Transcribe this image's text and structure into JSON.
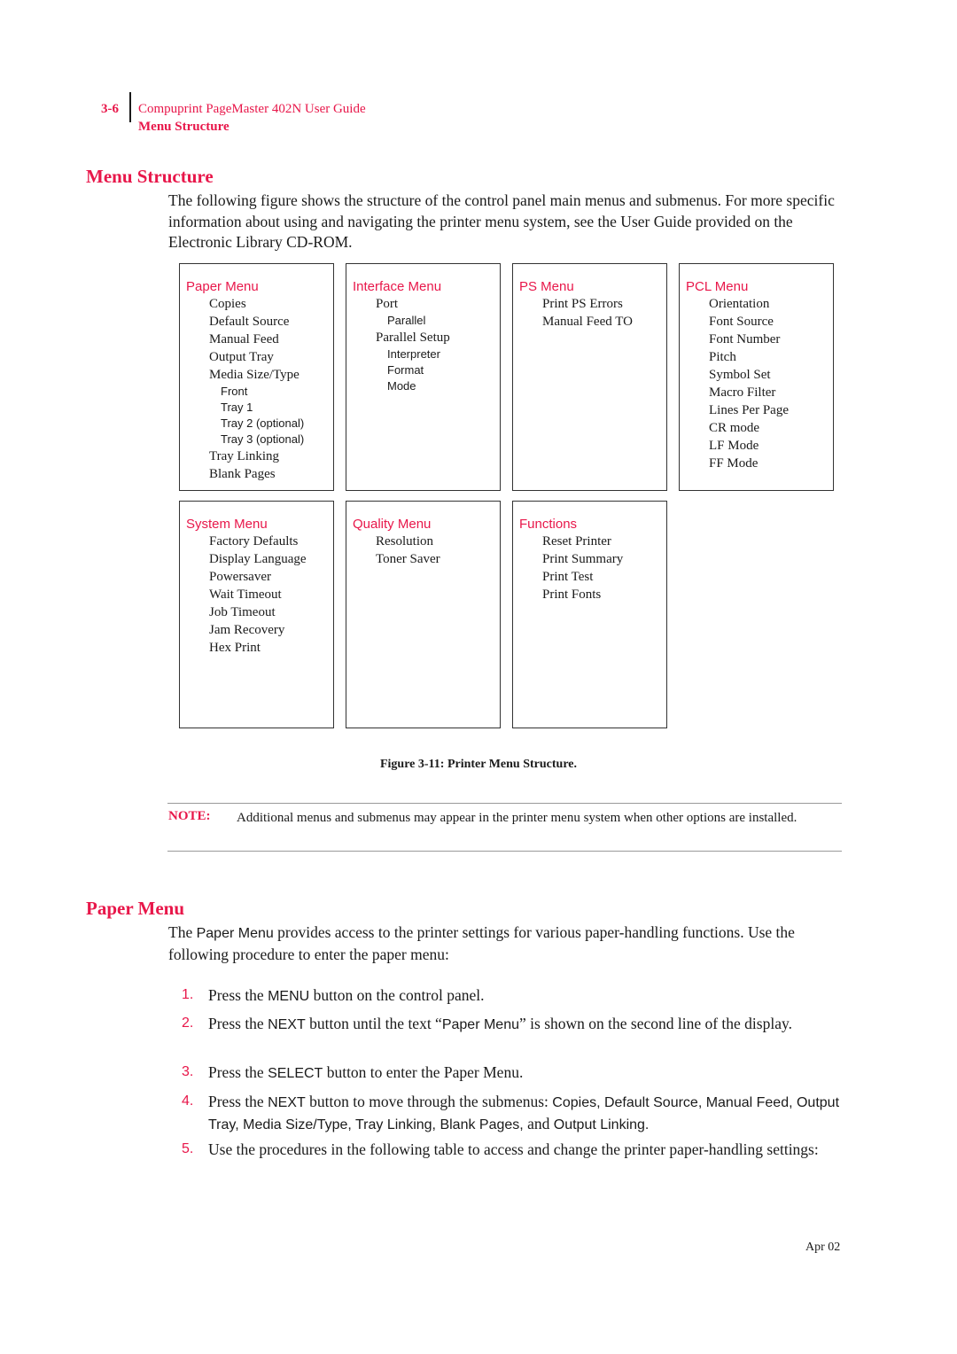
{
  "header": {
    "page_number": "3-6",
    "book_title": "Compuprint PageMaster 402N User Guide",
    "section": "Menu Structure"
  },
  "menu_structure": {
    "heading": "Menu Structure",
    "intro": "The following figure shows the structure of the control panel main menus and submenus. For more specific information about using and navigating the printer menu system, see the User Guide provided on the Electronic Library CD-ROM."
  },
  "figure": {
    "menus": [
      {
        "title": "Paper Menu",
        "items": [
          {
            "label": "Copies",
            "level": 1
          },
          {
            "label": "Default Source",
            "level": 1
          },
          {
            "label": "Manual Feed",
            "level": 1
          },
          {
            "label": "Output Tray",
            "level": 1
          },
          {
            "label": "Media Size/Type",
            "level": 1
          },
          {
            "label": "Front",
            "level": 2
          },
          {
            "label": "Tray 1",
            "level": 2
          },
          {
            "label": "Tray 2 (optional)",
            "level": 2
          },
          {
            "label": "Tray 3 (optional)",
            "level": 2
          },
          {
            "label": "Tray Linking",
            "level": 1
          },
          {
            "label": "Blank Pages",
            "level": 1
          }
        ]
      },
      {
        "title": "Interface Menu",
        "items": [
          {
            "label": "Port",
            "level": 1
          },
          {
            "label": "Parallel",
            "level": 2
          },
          {
            "label": "Parallel Setup",
            "level": 1
          },
          {
            "label": "Interpreter",
            "level": 2
          },
          {
            "label": "Format",
            "level": 2
          },
          {
            "label": "Mode",
            "level": 2
          }
        ]
      },
      {
        "title": "PS Menu",
        "items": [
          {
            "label": "Print PS Errors",
            "level": 1
          },
          {
            "label": "Manual Feed TO",
            "level": 1
          }
        ]
      },
      {
        "title": "PCL Menu",
        "items": [
          {
            "label": "Orientation",
            "level": 1
          },
          {
            "label": "Font Source",
            "level": 1
          },
          {
            "label": "Font Number",
            "level": 1
          },
          {
            "label": "Pitch",
            "level": 1
          },
          {
            "label": "Symbol Set",
            "level": 1
          },
          {
            "label": "Macro Filter",
            "level": 1
          },
          {
            "label": "Lines Per Page",
            "level": 1
          },
          {
            "label": "CR mode",
            "level": 1
          },
          {
            "label": "LF Mode",
            "level": 1
          },
          {
            "label": "FF Mode",
            "level": 1
          }
        ]
      },
      {
        "title": "System Menu",
        "items": [
          {
            "label": "Factory Defaults",
            "level": 1
          },
          {
            "label": "Display Language",
            "level": 1
          },
          {
            "label": "Powersaver",
            "level": 1
          },
          {
            "label": "Wait Timeout",
            "level": 1
          },
          {
            "label": "Job Timeout",
            "level": 1
          },
          {
            "label": "Jam Recovery",
            "level": 1
          },
          {
            "label": "Hex Print",
            "level": 1
          }
        ]
      },
      {
        "title": "Quality Menu",
        "items": [
          {
            "label": "Resolution",
            "level": 1
          },
          {
            "label": "Toner Saver",
            "level": 1
          }
        ]
      },
      {
        "title": "Functions",
        "items": [
          {
            "label": "Reset Printer",
            "level": 1
          },
          {
            "label": "Print Summary",
            "level": 1
          },
          {
            "label": "Print Test",
            "level": 1
          },
          {
            "label": "Print Fonts",
            "level": 1
          }
        ]
      }
    ],
    "caption": "Figure 3-11:  Printer Menu Structure."
  },
  "note": {
    "label": "NOTE:",
    "text": "Additional menus and submenus may appear in the printer menu system when other options are installed."
  },
  "paper_menu": {
    "heading": "Paper Menu",
    "intro_pre": "The ",
    "intro_code": "Paper Menu",
    "intro_post": " provides access to the printer settings for various paper-handling functions. Use the following procedure to enter the paper menu:",
    "steps": [
      {
        "num": "1.",
        "parts": [
          {
            "t": "Press the "
          },
          {
            "c": "MENU"
          },
          {
            "t": " button on the control panel."
          }
        ]
      },
      {
        "num": "2.",
        "parts": [
          {
            "t": "Press the "
          },
          {
            "c": "NEXT"
          },
          {
            "t": " button until the text “"
          },
          {
            "c": "Paper Menu"
          },
          {
            "t": "” is shown on the second line of the display."
          }
        ]
      },
      {
        "num": "3.",
        "parts": [
          {
            "t": "Press the "
          },
          {
            "c": "SELECT"
          },
          {
            "t": " button to enter the Paper Menu."
          }
        ]
      },
      {
        "num": "4.",
        "parts": [
          {
            "t": "Press the "
          },
          {
            "c": "NEXT"
          },
          {
            "t": " button to move through the submenus: "
          },
          {
            "c": "Copies, Default Source, Manual Feed, Output Tray, Media Size/Type, Tray Linking, Blank Pages,"
          },
          {
            "t": " and "
          },
          {
            "c": "Output Linking."
          }
        ]
      },
      {
        "num": "5.",
        "parts": [
          {
            "t": "Use the procedures in the following table to access and change the printer paper-handling settings:"
          }
        ]
      }
    ]
  },
  "footer": {
    "date": "Apr 02"
  },
  "colors": {
    "accent": "#e8174a",
    "text": "#1a1a1a"
  }
}
